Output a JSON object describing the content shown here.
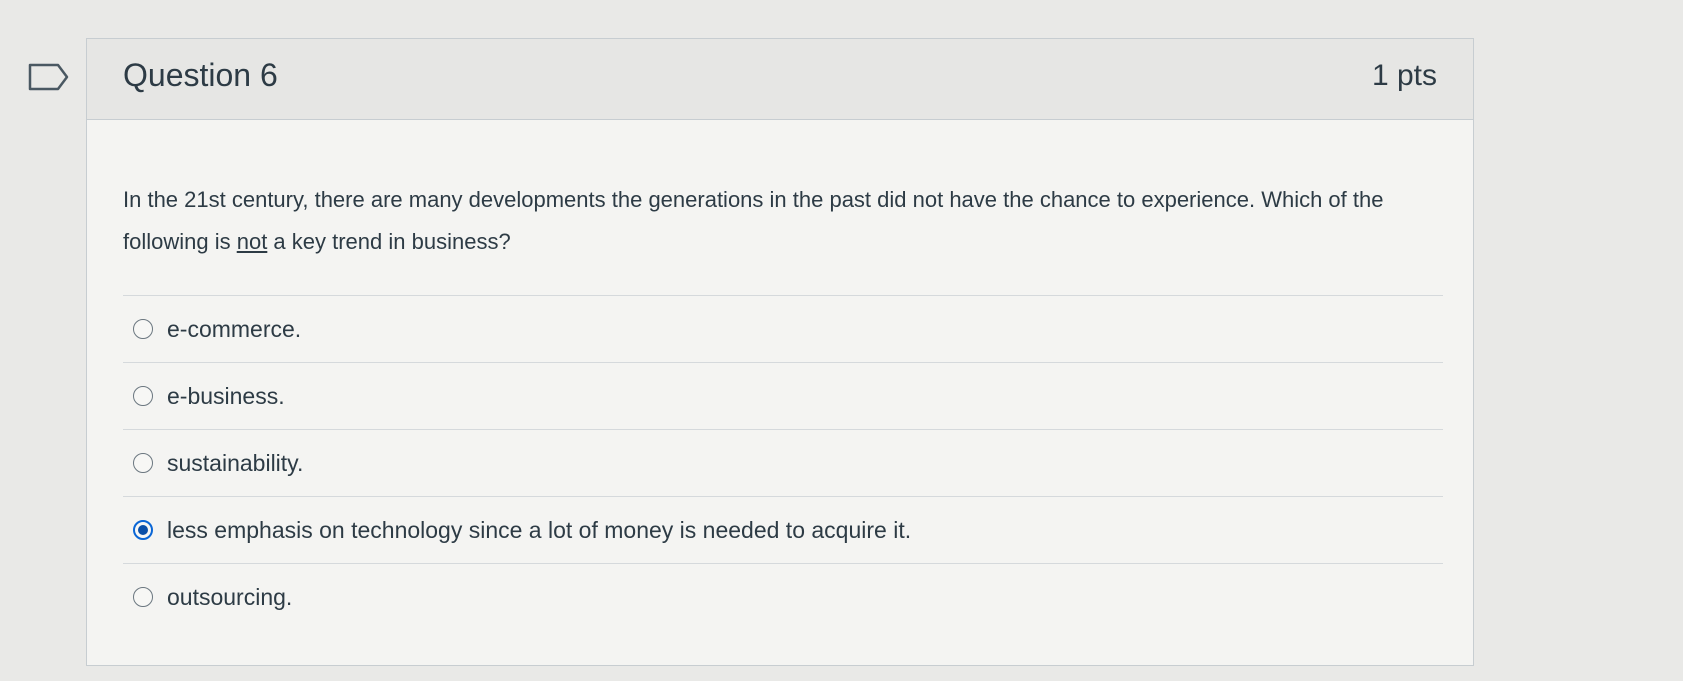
{
  "question": {
    "title": "Question 6",
    "points": "1 pts",
    "text_before": "In the 21st century, there are many developments the generations in the past did not have the chance to experience.  Which of the following is ",
    "text_emphasis": "not",
    "text_after": " a key trend in business?"
  },
  "answers": [
    {
      "label": "e-commerce.",
      "selected": false
    },
    {
      "label": "e-business.",
      "selected": false
    },
    {
      "label": "sustainability.",
      "selected": false
    },
    {
      "label": "less emphasis on technology since a lot of money is needed to acquire it.",
      "selected": true
    },
    {
      "label": "outsourcing.",
      "selected": false
    }
  ],
  "colors": {
    "accent": "#0a66d6",
    "text": "#2d3b45",
    "header_bg": "#e6e6e4"
  },
  "icons": {
    "flag": "flag-icon"
  }
}
